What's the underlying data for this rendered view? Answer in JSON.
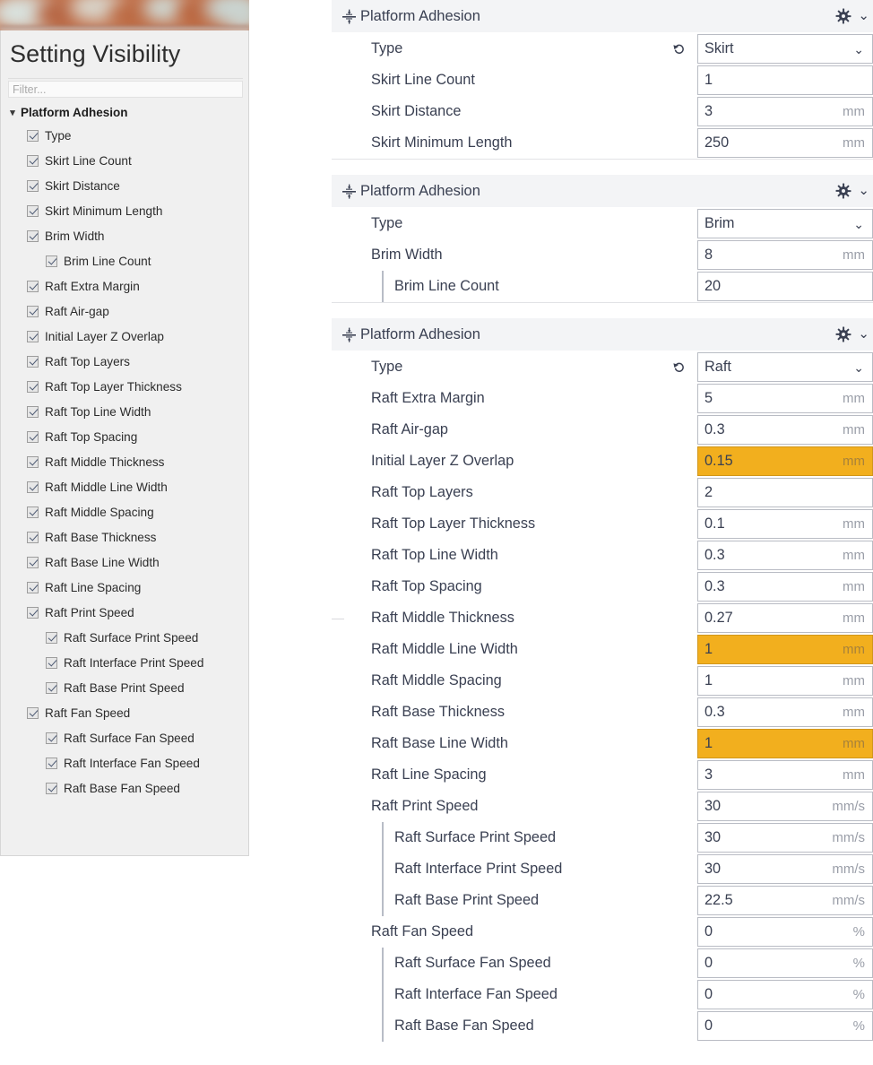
{
  "sidebar": {
    "title": "Setting Visibility",
    "filter": {
      "placeholder": "Filter...",
      "value": ""
    },
    "category": {
      "label": "Platform Adhesion",
      "expanded": true,
      "chevron": "chevron-down-icon"
    },
    "items": [
      {
        "label": "Type",
        "checked": true,
        "indent": 0
      },
      {
        "label": "Skirt Line Count",
        "checked": true,
        "indent": 0
      },
      {
        "label": "Skirt Distance",
        "checked": true,
        "indent": 0
      },
      {
        "label": "Skirt Minimum Length",
        "checked": true,
        "indent": 0
      },
      {
        "label": "Brim Width",
        "checked": true,
        "indent": 0
      },
      {
        "label": "Brim Line Count",
        "checked": true,
        "indent": 1
      },
      {
        "label": "Raft Extra Margin",
        "checked": true,
        "indent": 0
      },
      {
        "label": "Raft Air-gap",
        "checked": true,
        "indent": 0
      },
      {
        "label": "Initial Layer Z Overlap",
        "checked": true,
        "indent": 0
      },
      {
        "label": "Raft Top Layers",
        "checked": true,
        "indent": 0
      },
      {
        "label": "Raft Top Layer Thickness",
        "checked": true,
        "indent": 0
      },
      {
        "label": "Raft Top Line Width",
        "checked": true,
        "indent": 0
      },
      {
        "label": "Raft Top Spacing",
        "checked": true,
        "indent": 0
      },
      {
        "label": "Raft Middle Thickness",
        "checked": true,
        "indent": 0
      },
      {
        "label": "Raft Middle Line Width",
        "checked": true,
        "indent": 0
      },
      {
        "label": "Raft Middle Spacing",
        "checked": true,
        "indent": 0
      },
      {
        "label": "Raft Base Thickness",
        "checked": true,
        "indent": 0
      },
      {
        "label": "Raft Base Line Width",
        "checked": true,
        "indent": 0
      },
      {
        "label": "Raft Line Spacing",
        "checked": true,
        "indent": 0
      },
      {
        "label": "Raft Print Speed",
        "checked": true,
        "indent": 0
      },
      {
        "label": "Raft Surface Print Speed",
        "checked": true,
        "indent": 1
      },
      {
        "label": "Raft Interface Print Speed",
        "checked": true,
        "indent": 1
      },
      {
        "label": "Raft Base Print Speed",
        "checked": true,
        "indent": 1
      },
      {
        "label": "Raft Fan Speed",
        "checked": true,
        "indent": 0
      },
      {
        "label": "Raft Surface Fan Speed",
        "checked": true,
        "indent": 1
      },
      {
        "label": "Raft Interface Fan Speed",
        "checked": true,
        "indent": 1
      },
      {
        "label": "Raft Base Fan Speed",
        "checked": true,
        "indent": 1
      }
    ]
  },
  "colors": {
    "highlight": "#f2af1e",
    "header_bg": "#f3f4f6",
    "sidebar_bg": "#f0f0f0",
    "text": "#3a4052",
    "unit_text": "#9a9ea8",
    "banner": "#c4734d"
  },
  "sections": [
    {
      "title": "Platform Adhesion",
      "icon": "platform-adhesion-icon",
      "gear": "gear-icon",
      "chevron": "chevron-down-icon",
      "rows": [
        {
          "label": "Type",
          "value": "Skirt",
          "unit": "",
          "indent": 0,
          "control": "dropdown",
          "revert": true,
          "highlight": false
        },
        {
          "label": "Skirt Line Count",
          "value": "1",
          "unit": "",
          "indent": 0,
          "control": "text",
          "revert": false,
          "highlight": false
        },
        {
          "label": "Skirt Distance",
          "value": "3",
          "unit": "mm",
          "indent": 0,
          "control": "text",
          "revert": false,
          "highlight": false
        },
        {
          "label": "Skirt Minimum Length",
          "value": "250",
          "unit": "mm",
          "indent": 0,
          "control": "text",
          "revert": false,
          "highlight": false
        }
      ]
    },
    {
      "title": "Platform Adhesion",
      "icon": "platform-adhesion-icon",
      "gear": "gear-icon",
      "chevron": "chevron-down-icon",
      "rows": [
        {
          "label": "Type",
          "value": "Brim",
          "unit": "",
          "indent": 0,
          "control": "dropdown",
          "revert": false,
          "highlight": false
        },
        {
          "label": "Brim Width",
          "value": "8",
          "unit": "mm",
          "indent": 0,
          "control": "text",
          "revert": false,
          "highlight": false
        },
        {
          "label": "Brim Line Count",
          "value": "20",
          "unit": "",
          "indent": 1,
          "control": "text",
          "revert": false,
          "highlight": false
        }
      ]
    },
    {
      "title": "Platform Adhesion",
      "icon": "platform-adhesion-icon",
      "gear": "gear-icon",
      "chevron": "chevron-down-icon",
      "rows": [
        {
          "label": "Type",
          "value": "Raft",
          "unit": "",
          "indent": 0,
          "control": "dropdown",
          "revert": true,
          "highlight": false
        },
        {
          "label": "Raft Extra Margin",
          "value": "5",
          "unit": "mm",
          "indent": 0,
          "control": "text",
          "revert": false,
          "highlight": false
        },
        {
          "label": "Raft Air-gap",
          "value": "0.3",
          "unit": "mm",
          "indent": 0,
          "control": "text",
          "revert": false,
          "highlight": false
        },
        {
          "label": "Initial Layer Z Overlap",
          "value": "0.15",
          "unit": "mm",
          "indent": 0,
          "control": "text",
          "revert": false,
          "highlight": true
        },
        {
          "label": "Raft Top Layers",
          "value": "2",
          "unit": "",
          "indent": 0,
          "control": "text",
          "revert": false,
          "highlight": false
        },
        {
          "label": "Raft Top Layer Thickness",
          "value": "0.1",
          "unit": "mm",
          "indent": 0,
          "control": "text",
          "revert": false,
          "highlight": false
        },
        {
          "label": "Raft Top Line Width",
          "value": "0.3",
          "unit": "mm",
          "indent": 0,
          "control": "text",
          "revert": false,
          "highlight": false
        },
        {
          "label": "Raft Top Spacing",
          "value": "0.3",
          "unit": "mm",
          "indent": 0,
          "control": "text",
          "revert": false,
          "highlight": false
        },
        {
          "label": "Raft Middle Thickness",
          "value": "0.27",
          "unit": "mm",
          "indent": 0,
          "control": "text",
          "revert": false,
          "highlight": false
        },
        {
          "label": "Raft Middle Line Width",
          "value": "1",
          "unit": "mm",
          "indent": 0,
          "control": "text",
          "revert": false,
          "highlight": true
        },
        {
          "label": "Raft Middle Spacing",
          "value": "1",
          "unit": "mm",
          "indent": 0,
          "control": "text",
          "revert": false,
          "highlight": false
        },
        {
          "label": "Raft Base Thickness",
          "value": "0.3",
          "unit": "mm",
          "indent": 0,
          "control": "text",
          "revert": false,
          "highlight": false
        },
        {
          "label": "Raft Base Line Width",
          "value": "1",
          "unit": "mm",
          "indent": 0,
          "control": "text",
          "revert": false,
          "highlight": true
        },
        {
          "label": "Raft Line Spacing",
          "value": "3",
          "unit": "mm",
          "indent": 0,
          "control": "text",
          "revert": false,
          "highlight": false
        },
        {
          "label": "Raft Print Speed",
          "value": "30",
          "unit": "mm/s",
          "indent": 0,
          "control": "text",
          "revert": false,
          "highlight": false
        },
        {
          "label": "Raft Surface Print Speed",
          "value": "30",
          "unit": "mm/s",
          "indent": 1,
          "control": "text",
          "revert": false,
          "highlight": false
        },
        {
          "label": "Raft Interface Print Speed",
          "value": "30",
          "unit": "mm/s",
          "indent": 1,
          "control": "text",
          "revert": false,
          "highlight": false
        },
        {
          "label": "Raft Base Print Speed",
          "value": "22.5",
          "unit": "mm/s",
          "indent": 1,
          "control": "text",
          "revert": false,
          "highlight": false
        },
        {
          "label": "Raft Fan Speed",
          "value": "0",
          "unit": "%",
          "indent": 0,
          "control": "text",
          "revert": false,
          "highlight": false
        },
        {
          "label": "Raft Surface Fan Speed",
          "value": "0",
          "unit": "%",
          "indent": 1,
          "control": "text",
          "revert": false,
          "highlight": false
        },
        {
          "label": "Raft Interface Fan Speed",
          "value": "0",
          "unit": "%",
          "indent": 1,
          "control": "text",
          "revert": false,
          "highlight": false
        },
        {
          "label": "Raft Base Fan Speed",
          "value": "0",
          "unit": "%",
          "indent": 1,
          "control": "text",
          "revert": false,
          "highlight": false
        }
      ]
    }
  ]
}
